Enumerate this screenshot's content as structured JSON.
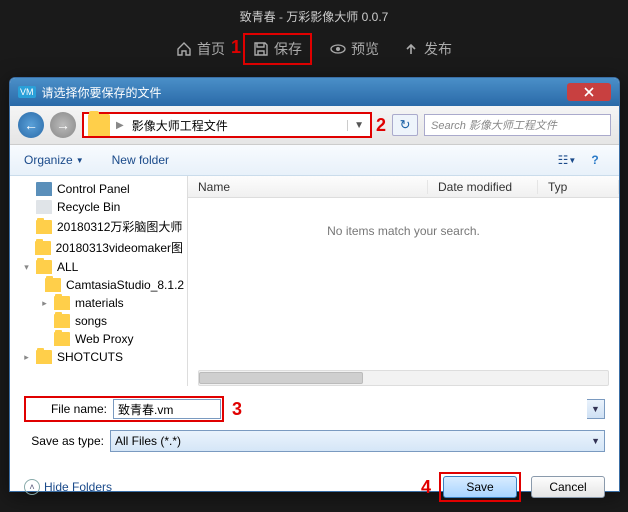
{
  "app": {
    "title": "致青春 - 万彩影像大师 0.0.7"
  },
  "toolbar": {
    "home": "首页",
    "save": "保存",
    "preview": "预览",
    "publish": "发布"
  },
  "markers": {
    "m1": "1",
    "m2": "2",
    "m3": "3",
    "m4": "4"
  },
  "dialog": {
    "title": "请选择你要保存的文件",
    "breadcrumb": "影像大师工程文件",
    "search_placeholder": "Search 影像大师工程文件",
    "organize": "Organize",
    "new_folder": "New folder",
    "columns": {
      "name": "Name",
      "date": "Date modified",
      "typ": "Typ"
    },
    "empty": "No items match your search.",
    "file_name_label": "File name:",
    "file_name_value": "致青春.vm",
    "save_type_label": "Save as type:",
    "save_type_value": "All Files (*.*)",
    "hide_folders": "Hide Folders",
    "save": "Save",
    "cancel": "Cancel"
  },
  "tree": [
    {
      "label": "Control Panel",
      "icon": "cp",
      "indent": 0,
      "caret": ""
    },
    {
      "label": "Recycle Bin",
      "icon": "rb",
      "indent": 0,
      "caret": ""
    },
    {
      "label": "20180312万彩脑图大师",
      "icon": "f",
      "indent": 0,
      "caret": ""
    },
    {
      "label": "20180313videomaker图",
      "icon": "f",
      "indent": 0,
      "caret": ""
    },
    {
      "label": "ALL",
      "icon": "f",
      "indent": 0,
      "caret": "▾"
    },
    {
      "label": "CamtasiaStudio_8.1.2",
      "icon": "f",
      "indent": 1,
      "caret": ""
    },
    {
      "label": "materials",
      "icon": "f",
      "indent": 1,
      "caret": "▸"
    },
    {
      "label": "songs",
      "icon": "f",
      "indent": 1,
      "caret": ""
    },
    {
      "label": "Web Proxy",
      "icon": "f",
      "indent": 1,
      "caret": ""
    },
    {
      "label": "SHOTCUTS",
      "icon": "f",
      "indent": 0,
      "caret": "▸"
    }
  ]
}
